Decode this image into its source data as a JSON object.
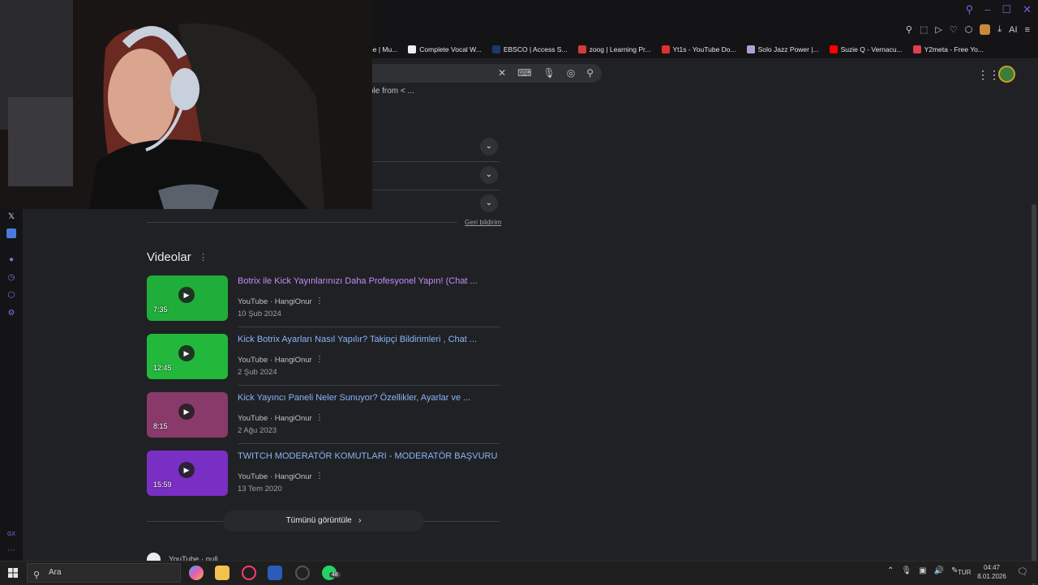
{
  "browser": {
    "bookmarks": [
      {
        "label": "ne | Mu...",
        "color": "#141417"
      },
      {
        "label": "Complete Vocal W...",
        "color": "#f0f0f0"
      },
      {
        "label": "EBSCO | Access S...",
        "color": "#1a3a6a"
      },
      {
        "label": "zoog | Learning Pr...",
        "color": "#d63a3a"
      },
      {
        "label": "Yt1s - YouTube Do...",
        "color": "#e03030"
      },
      {
        "label": "Solo Jazz Power |...",
        "color": "#b0a0d0"
      },
      {
        "label": "Suzie Q - Vernacu...",
        "color": "#ff0000"
      },
      {
        "label": "Y2meta - Free Yo...",
        "color": "#e04050"
      }
    ],
    "toolbar_ai_label": "AI"
  },
  "search": {
    "snippet": "ple from < ..."
  },
  "feedback_label": "Geri bildirim",
  "videos": {
    "title": "Videolar",
    "items": [
      {
        "title": "Botrix ile Kick Yayınlarınızı Daha Profesyonel Yapın! (Chat ...",
        "source": "YouTube · HangiOnur",
        "date": "10 Şub 2024",
        "duration": "7:35",
        "visited": true,
        "thumb_color": "#1fae3a"
      },
      {
        "title": "Kick Botrix Ayarları Nasıl Yapılır? Takipçi Bildirimleri , Chat ...",
        "source": "YouTube · HangiOnur",
        "date": "2 Şub 2024",
        "duration": "12:45",
        "visited": false,
        "thumb_color": "#22b83c"
      },
      {
        "title": "Kick Yayıncı Paneli Neler Sunuyor? Özellikler, Ayarlar ve ...",
        "source": "YouTube · HangiOnur",
        "date": "2 Ağu 2023",
        "duration": "8:15",
        "visited": false,
        "thumb_color": "#8a3a6a"
      },
      {
        "title": "TWITCH MODERATÖR KOMUTLARI - MODERATÖR BAŞVURU",
        "source": "YouTube · HangiOnur",
        "date": "13 Tem 2020",
        "duration": "15:59",
        "visited": false,
        "thumb_color": "#7a2fc4"
      }
    ],
    "view_all": "Tümünü görüntüle"
  },
  "next_result": {
    "source": "YouTube · null"
  },
  "taskbar": {
    "search_placeholder": "Ara",
    "whatsapp_badge": "48",
    "language": "TUR",
    "time": "04:47",
    "date": "8.01.2026",
    "notification_count": "2"
  }
}
